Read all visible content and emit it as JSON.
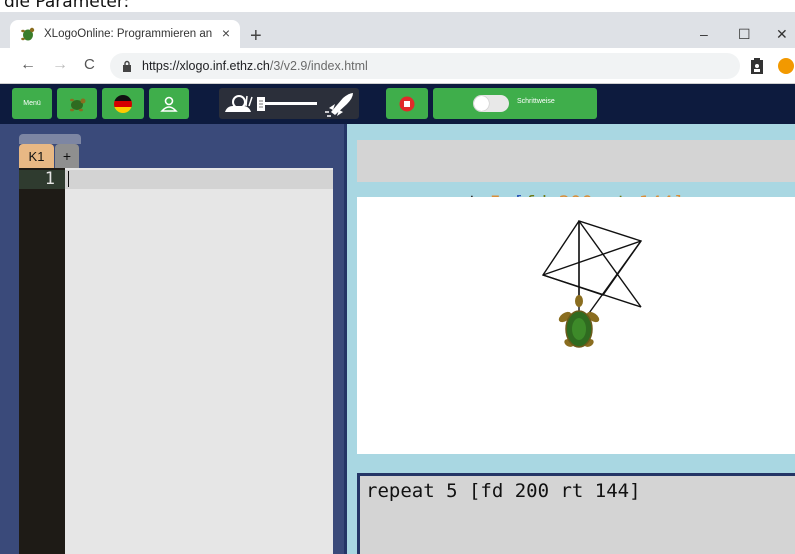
{
  "caption": "die Parameter:",
  "browser": {
    "tab_title": "XLogoOnline: Programmieren an",
    "tab_close": "×",
    "new_tab": "+",
    "url_host": "https://xlogo.inf.ethz.ch",
    "url_path": "/3/v2.9/index.html",
    "window_controls": [
      "–",
      "☐",
      "✕"
    ],
    "nav": [
      "←",
      "→",
      "C"
    ]
  },
  "toolbar": {
    "menu_label": "Menü",
    "step_label": "Schrittweise",
    "speed_level": 0.15,
    "step_mode": false
  },
  "editor": {
    "tabs": [
      "K1",
      "+"
    ],
    "line_numbers": [
      "1"
    ],
    "content": ""
  },
  "command": {
    "tokens": [
      {
        "text": "repeat",
        "type": "kw"
      },
      {
        "text": " ",
        "type": "kw"
      },
      {
        "text": "5",
        "type": "num"
      },
      {
        "text": " ",
        "type": "kw"
      },
      {
        "text": "[",
        "type": "br"
      },
      {
        "text": "fd",
        "type": "fn"
      },
      {
        "text": " ",
        "type": "kw"
      },
      {
        "text": "200",
        "type": "num"
      },
      {
        "text": " ",
        "type": "kw"
      },
      {
        "text": "rt",
        "type": "fn"
      },
      {
        "text": " ",
        "type": "kw"
      },
      {
        "text": "144",
        "type": "num"
      },
      {
        "text": "]",
        "type": "br2"
      }
    ]
  },
  "output": {
    "text": "repeat 5 [fd 200 rt 144]"
  },
  "colors": {
    "toolbar_bg": "#0d1b3e",
    "button_green": "#3fae4b",
    "left_panel": "#3a4a7a",
    "right_panel": "#a9d7e2",
    "tab_active": "#e8b884",
    "number_token": "#d98e3a",
    "function_token": "#6f7a15"
  },
  "icons": [
    "turtle-icon",
    "germany-flag-icon",
    "user-icon",
    "snail-icon",
    "rocket-icon",
    "stop-icon",
    "lock-icon",
    "clipboard-icon",
    "extension-icon"
  ]
}
